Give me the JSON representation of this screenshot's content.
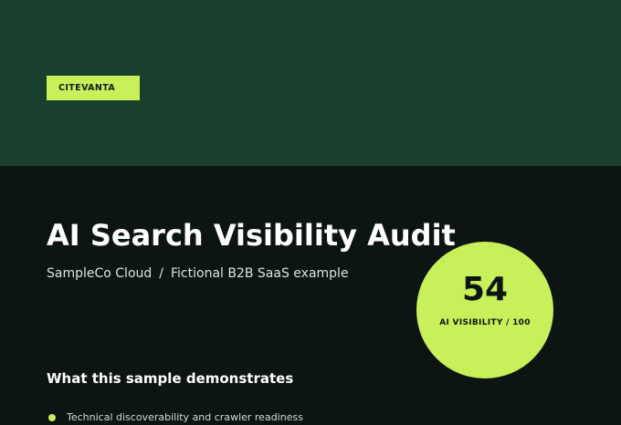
{
  "header": {
    "brand_tag": "CITEVANTA"
  },
  "report": {
    "title": "AI Search Visibility Audit",
    "subject": "SampleCo Cloud",
    "separator": "/",
    "description": "Fictional B2B SaaS example"
  },
  "score": {
    "value": "54",
    "label": "AI VISIBILITY / 100"
  },
  "highlights": {
    "heading": "What this sample demonstrates",
    "items": [
      {
        "label": "Technical discoverability and crawler readiness"
      }
    ]
  },
  "colors": {
    "header_background": "#1a3f2d",
    "page_background": "#0d1512",
    "accent": "#c8f05a"
  }
}
